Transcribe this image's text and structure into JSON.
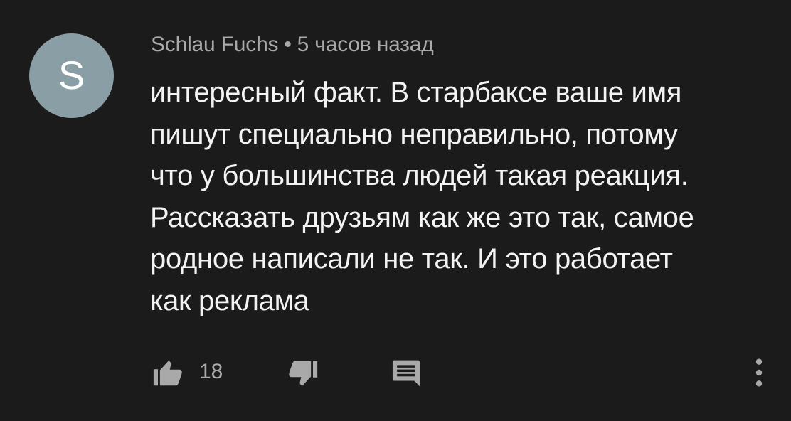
{
  "comment": {
    "avatar_letter": "S",
    "author": "Schlau Fuchs",
    "separator": "•",
    "time": "5 часов назад",
    "lines": [
      "интересный факт. В старбаксе ваше имя",
      "пишут специально неправильно, потому",
      "что у большинства людей такая реакция.",
      "Рассказать друзьям как же это так, самое",
      "родное написали не так. И это работает",
      "как реклама"
    ]
  },
  "actions": {
    "like_icon": "thumb-up-icon",
    "like_count": "18",
    "dislike_icon": "thumb-down-icon",
    "reply_icon": "comment-icon",
    "more_icon": "more-vertical-icon"
  },
  "colors": {
    "background": "#1b1b1b",
    "avatar": "#8a9ea5",
    "text": "#f3f3f3",
    "secondary_text": "#a9a9a9",
    "icon": "#a9a9a9"
  }
}
